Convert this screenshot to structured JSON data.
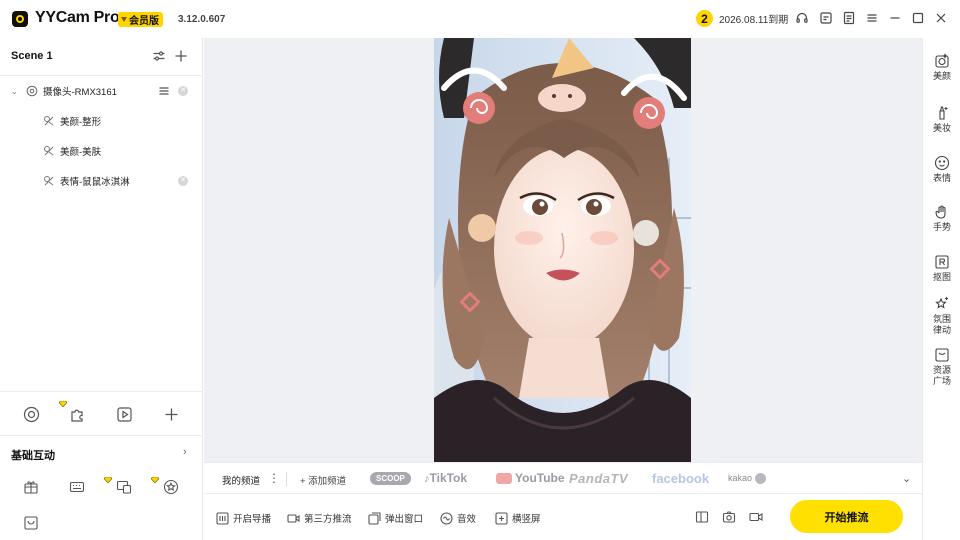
{
  "window": {
    "app_name": "YYCam Pro",
    "vip_badge": "会员版",
    "version": "3.12.0.607",
    "expire_count": "2",
    "expire_text": "2026.08.11到期"
  },
  "scene": {
    "title": "Scene 1",
    "camera_source": "摄像头-RMX3161",
    "effects": [
      {
        "label": "美颜-整形"
      },
      {
        "label": "美颜-美肤"
      },
      {
        "label": "表情-鼠鼠冰淇淋"
      }
    ]
  },
  "basic": {
    "title": "基础互动"
  },
  "channels": {
    "mine": "我的频道",
    "add": "+ 添加频道",
    "platforms": [
      "SCOOP",
      "TikTok",
      "YouTube",
      "PandaTV",
      "facebook",
      "kakao"
    ]
  },
  "bottombar": {
    "guide": "开启导播",
    "third_party": "第三方推流",
    "popout": "弹出窗口",
    "audio": "音效",
    "orientation": "横竖屏",
    "start_button": "开始推流"
  },
  "rail": [
    {
      "label": "美颜",
      "icon": "beauty-icon"
    },
    {
      "label": "美妆",
      "icon": "makeup-icon"
    },
    {
      "label": "表情",
      "icon": "emoji-icon"
    },
    {
      "label": "手势",
      "icon": "gesture-icon"
    },
    {
      "label": "抠图",
      "icon": "matting-icon"
    },
    {
      "label": "氛围律动",
      "icon": "ambience-icon"
    },
    {
      "label": "资源广场",
      "icon": "resource-icon"
    }
  ],
  "colors": {
    "accent": "#ffe000",
    "preview_bg": "#eef0f4"
  }
}
